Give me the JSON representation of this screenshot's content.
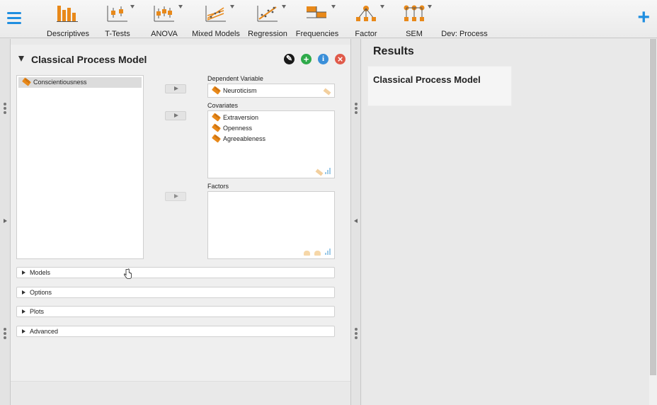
{
  "toolbar": {
    "items": [
      {
        "label": "Descriptives",
        "icon": "descriptives-icon",
        "dropdown": false
      },
      {
        "label": "T-Tests",
        "icon": "ttests-icon",
        "dropdown": true
      },
      {
        "label": "ANOVA",
        "icon": "anova-icon",
        "dropdown": true
      },
      {
        "label": "Mixed Models",
        "icon": "mixed-models-icon",
        "dropdown": true
      },
      {
        "label": "Regression",
        "icon": "regression-icon",
        "dropdown": true
      },
      {
        "label": "Frequencies",
        "icon": "frequencies-icon",
        "dropdown": true
      },
      {
        "label": "Factor",
        "icon": "factor-icon",
        "dropdown": true
      },
      {
        "label": "SEM",
        "icon": "sem-icon",
        "dropdown": true
      },
      {
        "label": "Dev: Process",
        "icon": "",
        "dropdown": false
      }
    ],
    "plus": "+"
  },
  "analysis": {
    "title": "Classical Process Model",
    "header_icons": {
      "edit": "✎",
      "add": "+",
      "info": "i",
      "close": "×"
    },
    "source_variables": [
      {
        "name": "Conscientiousness",
        "selected": true
      }
    ],
    "dependent_label": "Dependent Variable",
    "dependent_value": "Neuroticism",
    "covariates_label": "Covariates",
    "covariates": [
      "Extraversion",
      "Openness",
      "Agreeableness"
    ],
    "factors_label": "Factors",
    "sections": [
      "Models",
      "Options",
      "Plots",
      "Advanced"
    ]
  },
  "results": {
    "title": "Results",
    "card_title": "Classical Process Model"
  },
  "colors": {
    "accent_blue": "#1f8ee0",
    "icon_orange": "#e8891a",
    "edit_button": "#1a1a1a",
    "add_button": "#2eaa4a",
    "info_button": "#3a8fd9",
    "close_button": "#e05a4a"
  }
}
